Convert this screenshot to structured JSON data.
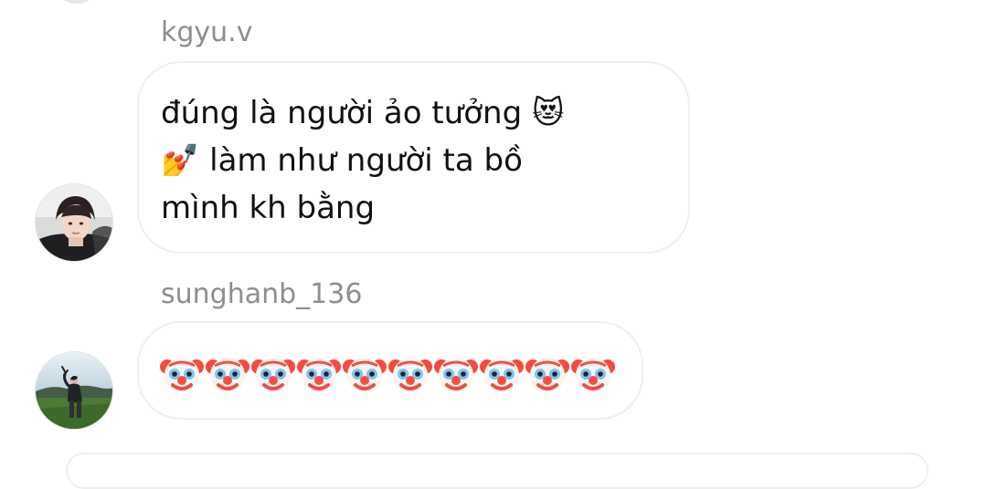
{
  "messages": [
    {
      "sender": "kgyu.v",
      "lines": [
        "đúng là người ảo tưởng 😻",
        "💅 làm như người ta bồ",
        "mình kh bằng"
      ],
      "avatar_icon": "user-avatar-icon"
    },
    {
      "sender": "sunghanb_136",
      "emoji_text": "🤡🤡🤡🤡🤡🤡🤡🤡🤡🤡",
      "emoji_icon": "clown-face-icon",
      "avatar_icon": "user-avatar-icon"
    }
  ],
  "colors": {
    "background": "#ffffff",
    "sender_name": "#8e8e8e",
    "bubble_border": "#efefef",
    "message_text": "#111111"
  }
}
